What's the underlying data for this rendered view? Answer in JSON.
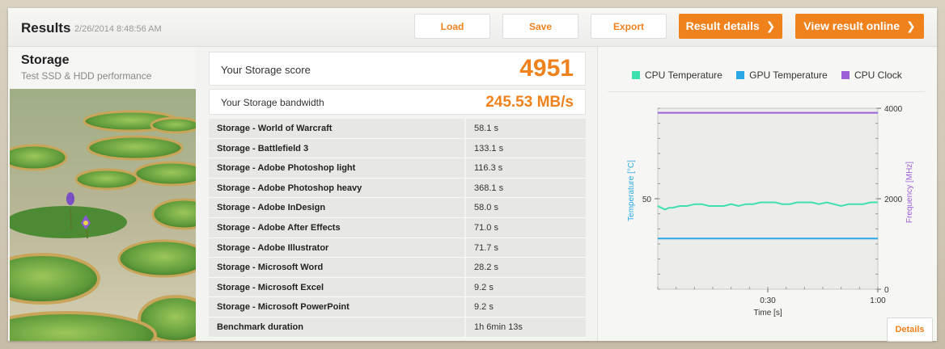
{
  "header": {
    "title": "Results",
    "timestamp": "2/26/2014 8:48:56 AM",
    "buttons": {
      "load": "Load",
      "save": "Save",
      "export": "Export",
      "result_details": "Result details",
      "view_online": "View result online"
    },
    "chevron": "❯"
  },
  "test": {
    "name": "Storage",
    "description": "Test SSD & HDD performance",
    "image_icon": "water-lily-photo"
  },
  "score": {
    "label": "Your Storage score",
    "value": "4951"
  },
  "bandwidth": {
    "label": "Your Storage bandwidth",
    "value": "245.53 MB/s"
  },
  "results": [
    {
      "name": "Storage - World of Warcraft",
      "value": "58.1 s"
    },
    {
      "name": "Storage - Battlefield 3",
      "value": "133.1 s"
    },
    {
      "name": "Storage - Adobe Photoshop light",
      "value": "116.3 s"
    },
    {
      "name": "Storage - Adobe Photoshop heavy",
      "value": "368.1 s"
    },
    {
      "name": "Storage - Adobe InDesign",
      "value": "58.0 s"
    },
    {
      "name": "Storage - Adobe After Effects",
      "value": "71.0 s"
    },
    {
      "name": "Storage - Adobe Illustrator",
      "value": "71.7 s"
    },
    {
      "name": "Storage - Microsoft Word",
      "value": "28.2 s"
    },
    {
      "name": "Storage - Microsoft Excel",
      "value": "9.2 s"
    },
    {
      "name": "Storage - Microsoft PowerPoint",
      "value": "9.2 s"
    },
    {
      "name": "Benchmark duration",
      "value": "1h 6min 13s"
    }
  ],
  "colors": {
    "accent": "#f0821e",
    "cpu_temp": "#3fe0b0",
    "gpu_temp": "#2aa8e6",
    "cpu_clock": "#9b5fd6"
  },
  "chart_data": {
    "type": "line",
    "xlabel": "Time [s]",
    "ylabel_left": "Temperature [°C]",
    "ylabel_right": "Frequency [MHz]",
    "x_tick_labels": [
      "0:30",
      "1:00"
    ],
    "x_range": [
      0,
      60
    ],
    "y_left_ticks": [
      "50"
    ],
    "y_left_range": [
      0,
      100
    ],
    "y_right_ticks": [
      "0",
      "2000",
      "4000"
    ],
    "y_right_range": [
      0,
      4000
    ],
    "legend_position": "top",
    "series": [
      {
        "name": "CPU Temperature",
        "axis": "left",
        "x": [
          0,
          1,
          2,
          3,
          4,
          6,
          8,
          10,
          12,
          14,
          16,
          18,
          20,
          22,
          24,
          26,
          28,
          30,
          32,
          34,
          36,
          38,
          40,
          42,
          44,
          46,
          48,
          50,
          52,
          54,
          56,
          58,
          60
        ],
        "values": [
          46,
          45,
          44,
          45,
          45,
          46,
          46,
          47,
          47,
          46,
          46,
          46,
          47,
          46,
          47,
          47,
          48,
          48,
          48,
          47,
          47,
          48,
          48,
          48,
          47,
          48,
          47,
          46,
          47,
          47,
          47,
          48,
          48
        ]
      },
      {
        "name": "GPU Temperature",
        "axis": "left",
        "x": [
          0,
          60
        ],
        "values": [
          28,
          28
        ]
      },
      {
        "name": "CPU Clock",
        "axis": "right",
        "x": [
          0,
          60
        ],
        "values": [
          3900,
          3900
        ]
      }
    ]
  },
  "details_button": "Details"
}
